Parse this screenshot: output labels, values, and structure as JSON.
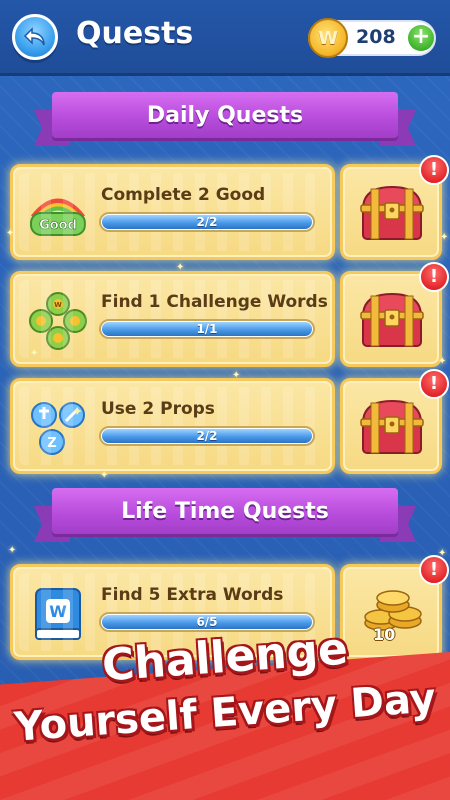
{
  "header": {
    "title": "Quests",
    "coin_symbol": "W",
    "coin_count": "208",
    "plus_label": "+"
  },
  "sections": [
    {
      "title": "Daily Quests"
    },
    {
      "title": "Life Time Quests"
    }
  ],
  "daily_quests": [
    {
      "label": "Complete 2 Good",
      "icon": "good-badge-icon",
      "icon_text": "Good",
      "progress_text": "2/2",
      "progress": 1.0,
      "reward": "chest-icon",
      "alert": "!"
    },
    {
      "label": "Find 1 Challenge Words",
      "icon": "challenge-words-icon",
      "icon_text": "W",
      "progress_text": "1/1",
      "progress": 1.0,
      "reward": "chest-icon",
      "alert": "!"
    },
    {
      "label": "Use 2 Props",
      "icon": "props-icon",
      "icon_text": "Z",
      "progress_text": "2/2",
      "progress": 1.0,
      "reward": "chest-icon",
      "alert": "!"
    }
  ],
  "lifetime_quests": [
    {
      "label": "Find 5 Extra Words",
      "icon": "extra-words-book-icon",
      "icon_text": "W",
      "progress_text": "6/5",
      "progress": 1.0,
      "reward": "coin-stack-icon",
      "reward_amount": "10",
      "alert": "!"
    }
  ],
  "banner": {
    "line1": "Challenge",
    "line2": "Yourself Every Day"
  },
  "colors": {
    "background": "#2a62b7",
    "ribbon": "#b94ddd",
    "card": "#f6d983",
    "progress": "#4a9ae8",
    "banner": "#e63a32",
    "alert": "#e3272b"
  }
}
